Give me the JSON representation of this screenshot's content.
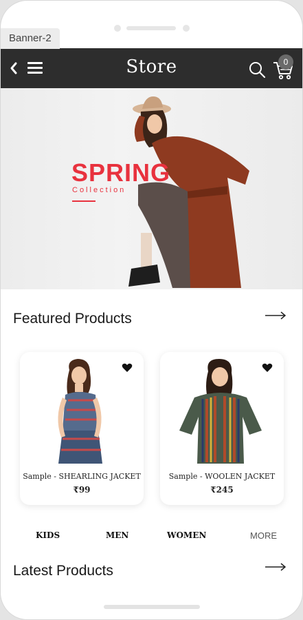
{
  "screen_label": "Banner-2",
  "header": {
    "title": "Store",
    "cart_count": "0",
    "icons": [
      "back-icon",
      "menu-icon",
      "search-icon",
      "cart-icon"
    ]
  },
  "banner": {
    "title": "SPRING",
    "subtitle": "Collection"
  },
  "featured": {
    "title": "Featured Products",
    "products": [
      {
        "name": "Sample - SHEARLING JACKET",
        "price": "₹99"
      },
      {
        "name": "Sample - WOOLEN JACKET",
        "price": "₹245"
      }
    ]
  },
  "categories": [
    "KIDS",
    "MEN",
    "WOMEN",
    "MORE"
  ],
  "latest": {
    "title": "Latest Products"
  },
  "colors": {
    "header_bg": "#2d2d2d",
    "accent": "#e8323e"
  }
}
